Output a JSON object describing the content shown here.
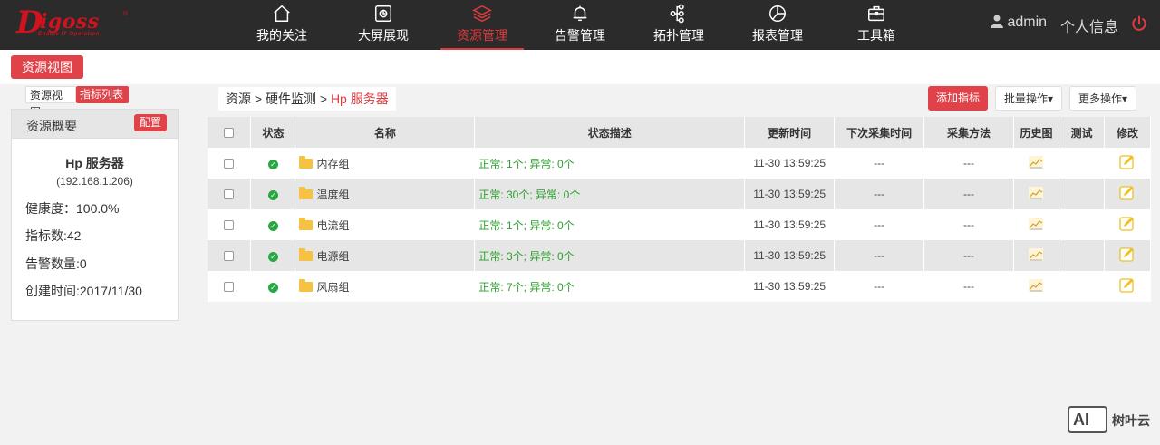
{
  "logo": {
    "letter": "D",
    "word": "igoss",
    "reg": "®",
    "tagline": "Enable IT Operation"
  },
  "nav": [
    {
      "label": "我的关注",
      "icon": "home-icon"
    },
    {
      "label": "大屏展现",
      "icon": "monitor-icon"
    },
    {
      "label": "资源管理",
      "icon": "layers-icon",
      "active": true
    },
    {
      "label": "告警管理",
      "icon": "bell-icon"
    },
    {
      "label": "拓扑管理",
      "icon": "topology-icon"
    },
    {
      "label": "报表管理",
      "icon": "pie-chart-icon"
    },
    {
      "label": "工具箱",
      "icon": "toolbox-icon"
    }
  ],
  "header": {
    "user": "admin",
    "profile": "个人信息",
    "power_icon": "power-icon"
  },
  "subbar": {
    "view_button": "资源视图"
  },
  "left_tabs": {
    "tab1": "资源视图",
    "tab2": "指标列表"
  },
  "panel": {
    "title": "资源概要",
    "config_button": "配置",
    "name": "Hp 服务器",
    "ip": "(192.168.1.206)",
    "health": "健康度：100.0%",
    "metrics": "指标数:42",
    "alerts": "告警数量:0",
    "created": "创建时间:2017/11/30"
  },
  "breadcrumb": {
    "part1": "资源",
    "sep": ">",
    "part2": "硬件监测",
    "current": "Hp 服务器"
  },
  "actions": {
    "add": "添加指标",
    "batch": "批量操作▾",
    "more": "更多操作▾"
  },
  "table": {
    "headers": {
      "status": "状态",
      "name": "名称",
      "desc": "状态描述",
      "updated": "更新时间",
      "next": "下次采集时间",
      "method": "采集方法",
      "history": "历史图",
      "test": "测试",
      "edit": "修改"
    },
    "rows": [
      {
        "name": "内存组",
        "desc": "正常: 1个; 异常: 0个",
        "updated": "11-30 13:59:25",
        "next": "---",
        "method": "---"
      },
      {
        "name": "温度组",
        "desc": "正常: 30个; 异常: 0个",
        "updated": "11-30 13:59:25",
        "next": "---",
        "method": "---"
      },
      {
        "name": "电流组",
        "desc": "正常: 1个; 异常: 0个",
        "updated": "11-30 13:59:25",
        "next": "---",
        "method": "---"
      },
      {
        "name": "电源组",
        "desc": "正常: 3个; 异常: 0个",
        "updated": "11-30 13:59:25",
        "next": "---",
        "method": "---"
      },
      {
        "name": "风扇组",
        "desc": "正常: 7个; 异常: 0个",
        "updated": "11-30 13:59:25",
        "next": "---",
        "method": "---"
      }
    ]
  },
  "watermark": {
    "badge": "AI",
    "text": "树叶云"
  },
  "colors": {
    "accent": "#e0424a",
    "topbar": "#2b2b2b",
    "ok": "#28a745",
    "folder": "#f5c242"
  }
}
